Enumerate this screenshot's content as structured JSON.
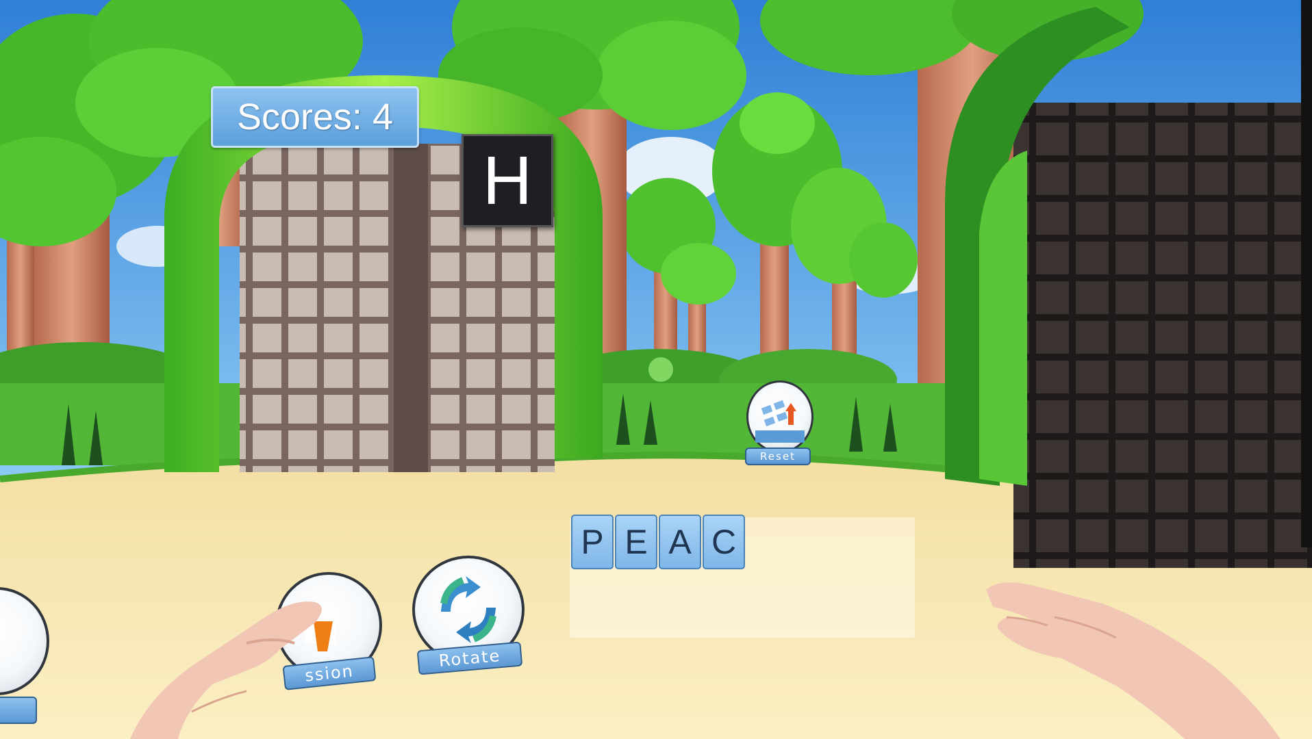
{
  "hud": {
    "score_text": "Scores: 4",
    "falling_letter": "H"
  },
  "word": {
    "letters": [
      "P",
      "E",
      "A",
      "C"
    ]
  },
  "tools": {
    "reset_label": "Reset",
    "rotate_label": "Rotate",
    "session_label": "ssion"
  },
  "colors": {
    "sky": "#6fb8f0",
    "sand": "#f7e7b0",
    "foliage": "#5ccf3c",
    "panel_blue": "#6aa9e2"
  }
}
